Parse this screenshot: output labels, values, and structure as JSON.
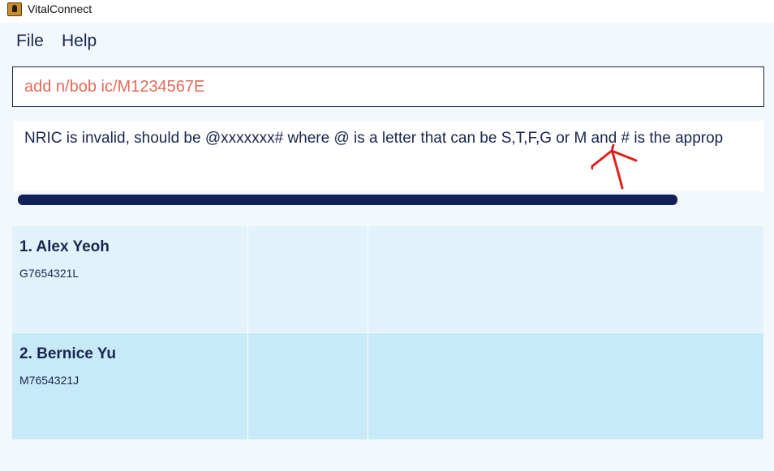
{
  "window": {
    "title": "VitalConnect",
    "icon": "address-book-icon"
  },
  "menu": {
    "items": [
      "File",
      "Help"
    ]
  },
  "command": {
    "value": "add n/bob ic/M1234567E",
    "color": "#e06b57"
  },
  "result": {
    "message": "NRIC is invalid, should be @xxxxxxx# where @ is a letter that can be S,T,F,G or M and # is the approp"
  },
  "persons": [
    {
      "index_name": "1. Alex Yeoh",
      "nric": "G7654321L"
    },
    {
      "index_name": "2. Bernice Yu",
      "nric": "M7654321J"
    }
  ],
  "colors": {
    "primary_text": "#1a2550",
    "scrollbar": "#12205a",
    "card_odd": "#e1f2fb",
    "card_even": "#c8e9f8",
    "annotation": "#e0201a"
  }
}
